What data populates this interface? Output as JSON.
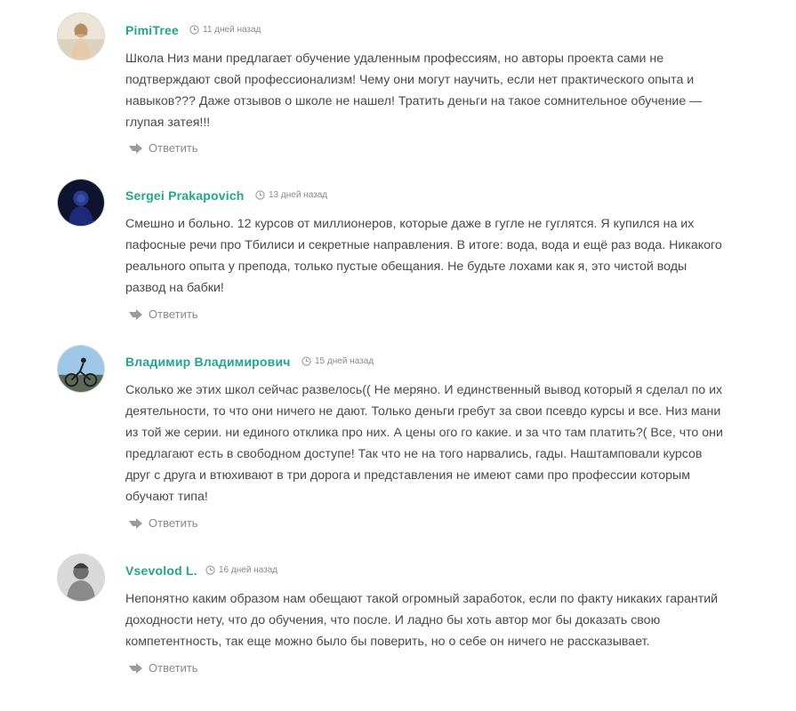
{
  "comments": [
    {
      "author": "PimiTree",
      "date": "11 дней назад",
      "text": "Школа Низ мани предлагает обучение удаленным профессиям, но авторы проекта сами не подтверждают свой профессионализм! Чему они могут научить, если нет практического опыта и навыков??? Даже отзывов о школе не нашел! Тратить деньги на такое сомнительное обучение — глупая затея!!!",
      "reply_label": "Ответить"
    },
    {
      "author": "Sergei Prakapovich",
      "date": "13 дней назад",
      "text": "Смешно и больно. 12 курсов от миллионеров, которые даже в гугле не гуглятся. Я купился на их пафосные речи про Тбилиси и секретные направления. В итоге: вода, вода и ещё раз вода. Никакого реального опыта у препода, только пустые обещания. Не будьте лохами как я, это чистой воды развод на бабки!",
      "reply_label": "Ответить"
    },
    {
      "author": "Владимир Владимирович",
      "date": "15 дней назад",
      "text": "Сколько же этих школ сейчас развелось(( Не меряно. И единственный вывод который я сделал по их деятельности, то что они ничего не дают. Только деньги гребут за свои псевдо курсы и все. Низ мани из той же серии. ни единого отклика про них. А цены ого го какие. и за что там платить?( Все, что они предлагают есть в свободном доступе! Так что не на того нарвались, гады. Наштамповали курсов друг с друга и втюхивают в три дорога и представления не имеют сами про профессии которым обучают типа!",
      "reply_label": "Ответить"
    },
    {
      "author": "Vsevolod L.",
      "date": "16 дней назад",
      "text": "Непонятно каким образом нам обещают такой огромный заработок, если по факту никаких гарантий доходности нету, что до обучения, что после. И ладно бы хоть автор мог бы доказать свою компетентность, так еще можно было бы поверить, но о себе он ничего не рассказывает.",
      "reply_label": "Ответить"
    }
  ],
  "colors": {
    "author": "#21a58d",
    "text": "#4a4a4a",
    "meta": "#8a8a8a"
  },
  "icons": {
    "date": "clock-icon",
    "reply": "reply-arrow-icon"
  }
}
